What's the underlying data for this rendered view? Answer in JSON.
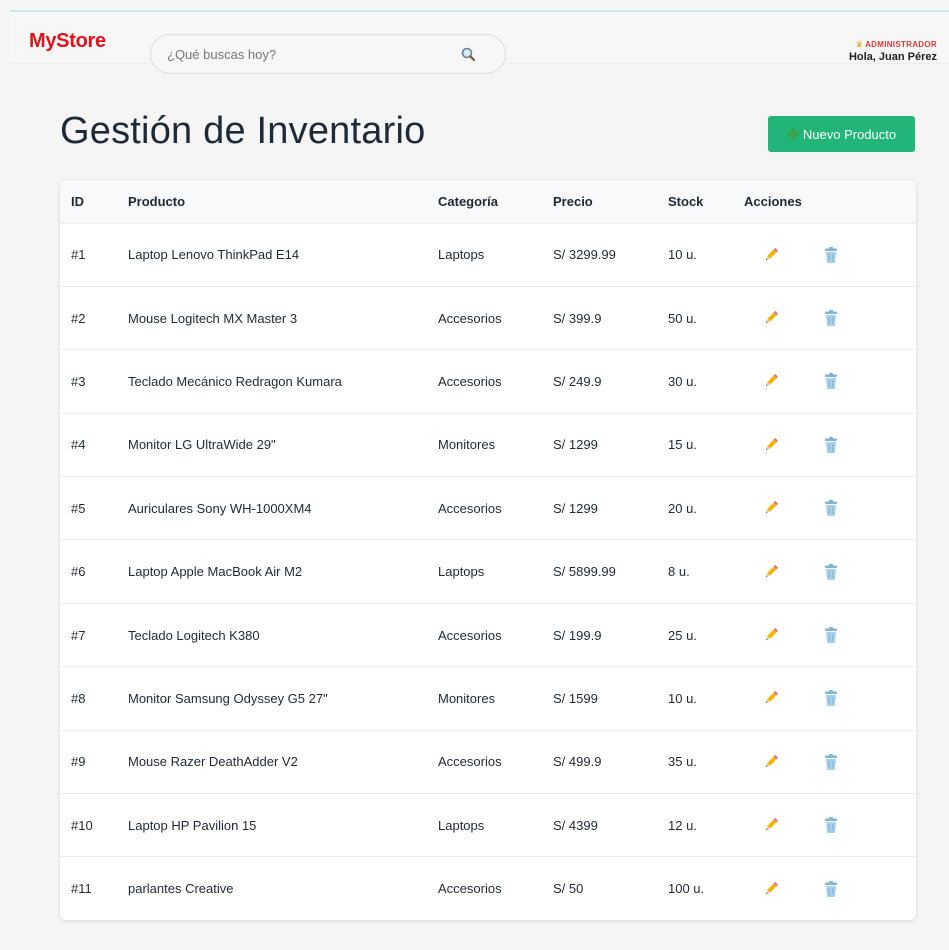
{
  "navbar": {
    "brand": "MyStore",
    "search_placeholder": "¿Qué buscas hoy?",
    "search_icon": "search-icon",
    "role_icon": "crown-icon",
    "role": "ADMINISTRADOR",
    "greeting": "Hola, Juan Pérez"
  },
  "page": {
    "title": "Gestión de Inventario",
    "new_button": "Nuevo Producto",
    "new_button_icon": "plus-icon"
  },
  "colors": {
    "brand": "#e3121b",
    "primary_button": "#22b57a",
    "role": "#d43c3c"
  },
  "table": {
    "headers": [
      "ID",
      "Producto",
      "Categoría",
      "Precio",
      "Stock",
      "Acciones"
    ],
    "action_icons": [
      "pencil-icon",
      "trash-icon"
    ],
    "rows": [
      {
        "id": "#1",
        "product": "Laptop Lenovo ThinkPad E14",
        "category": "Laptops",
        "price": "S/ 3299.99",
        "stock": "10 u."
      },
      {
        "id": "#2",
        "product": "Mouse Logitech MX Master 3",
        "category": "Accesorios",
        "price": "S/ 399.9",
        "stock": "50 u."
      },
      {
        "id": "#3",
        "product": "Teclado Mecánico Redragon Kumara",
        "category": "Accesorios",
        "price": "S/ 249.9",
        "stock": "30 u."
      },
      {
        "id": "#4",
        "product": "Monitor LG UltraWide 29\"",
        "category": "Monitores",
        "price": "S/ 1299",
        "stock": "15 u."
      },
      {
        "id": "#5",
        "product": "Auriculares Sony WH-1000XM4",
        "category": "Accesorios",
        "price": "S/ 1299",
        "stock": "20 u."
      },
      {
        "id": "#6",
        "product": "Laptop Apple MacBook Air M2",
        "category": "Laptops",
        "price": "S/ 5899.99",
        "stock": "8 u."
      },
      {
        "id": "#7",
        "product": "Teclado Logitech K380",
        "category": "Accesorios",
        "price": "S/ 199.9",
        "stock": "25 u."
      },
      {
        "id": "#8",
        "product": "Monitor Samsung Odyssey G5 27\"",
        "category": "Monitores",
        "price": "S/ 1599",
        "stock": "10 u."
      },
      {
        "id": "#9",
        "product": "Mouse Razer DeathAdder V2",
        "category": "Accesorios",
        "price": "S/ 499.9",
        "stock": "35 u."
      },
      {
        "id": "#10",
        "product": "Laptop HP Pavilion 15",
        "category": "Laptops",
        "price": "S/ 4399",
        "stock": "12 u."
      },
      {
        "id": "#11",
        "product": "parlantes Creative",
        "category": "Accesorios",
        "price": "S/ 50",
        "stock": "100 u."
      }
    ]
  }
}
